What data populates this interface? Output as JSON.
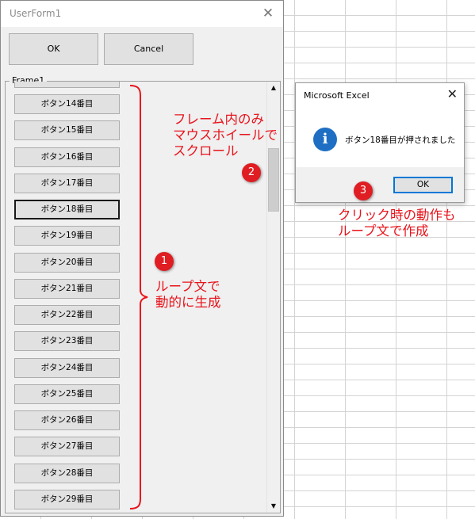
{
  "userform": {
    "title": "UserForm1",
    "close_glyph": "✕",
    "ok_label": "OK",
    "cancel_label": "Cancel",
    "frame_caption": "Frame1",
    "loop_buttons": [
      {
        "label": ""
      },
      {
        "label": "ボタン14番目"
      },
      {
        "label": "ボタン15番目"
      },
      {
        "label": "ボタン16番目"
      },
      {
        "label": "ボタン17番目"
      },
      {
        "label": "ボタン18番目"
      },
      {
        "label": "ボタン19番目"
      },
      {
        "label": "ボタン20番目"
      },
      {
        "label": "ボタン21番目"
      },
      {
        "label": "ボタン22番目"
      },
      {
        "label": "ボタン23番目"
      },
      {
        "label": "ボタン24番目"
      },
      {
        "label": "ボタン25番目"
      },
      {
        "label": "ボタン26番目"
      },
      {
        "label": "ボタン27番目"
      },
      {
        "label": "ボタン28番目"
      },
      {
        "label": "ボタン29番目"
      }
    ],
    "focused_button": "ボタン18番目",
    "scroll_up_glyph": "▲",
    "scroll_down_glyph": "▼"
  },
  "msgbox": {
    "title": "Microsoft Excel",
    "close_glyph": "✕",
    "icon": "info-icon",
    "icon_glyph": "i",
    "message": "ボタン18番目が押されました",
    "ok_label": "OK"
  },
  "annotations": {
    "badge1": "1",
    "badge2": "2",
    "badge3": "3",
    "note_loop": "ループ文で\n動的に生成",
    "note_scroll": "フレーム内のみ\nマウスホイールで\nスクロール",
    "note_click": "クリック時の動作も\nループ文で作成"
  },
  "colors": {
    "annotation_red": "#e8141c",
    "badge_red": "#df1d22",
    "info_blue": "#1e6fc4",
    "focus_blue": "#0078d7"
  }
}
